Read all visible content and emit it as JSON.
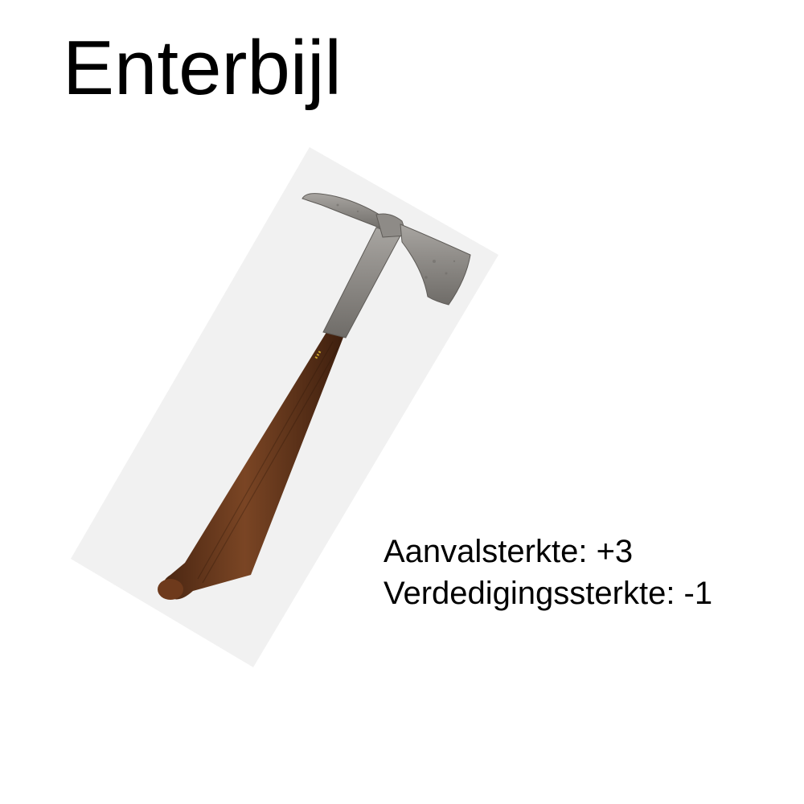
{
  "slide": {
    "title": "Enterbijl",
    "image": {
      "icon": "boarding-axe-photo"
    },
    "stats": [
      {
        "text": "Aanvalsterkte: +3"
      },
      {
        "text": "Verdedigingssterkte: -1"
      }
    ]
  },
  "colors": {
    "background": "#ffffff",
    "text": "#000000",
    "photo_backdrop": "#f1f1f1",
    "axe_steel": "#8c8a87",
    "handle_wood": "#6b3a1e"
  }
}
